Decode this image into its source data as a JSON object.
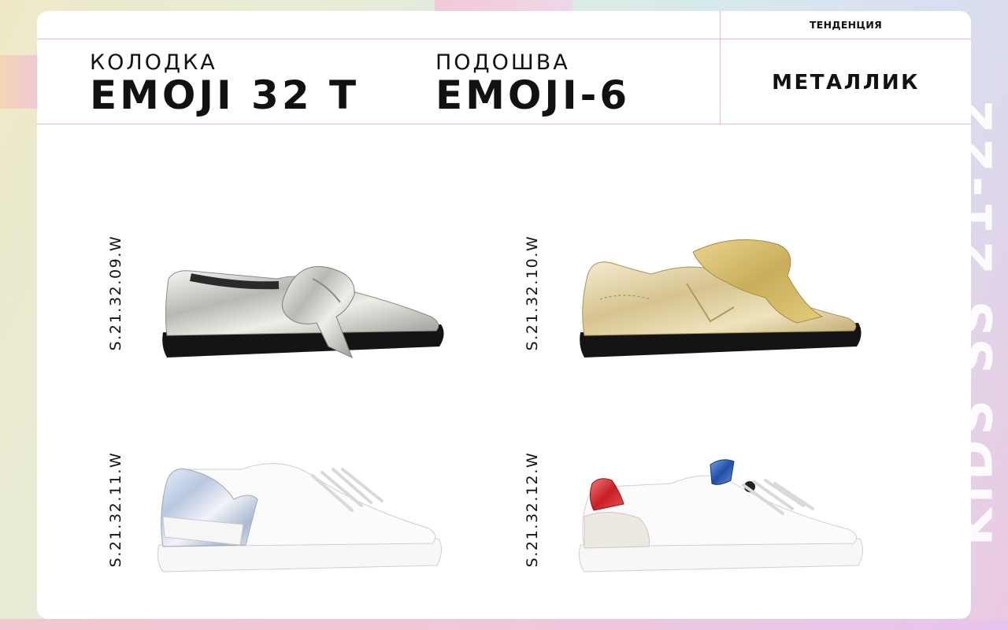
{
  "header": {
    "last_label": "КОЛОДКА",
    "last_value": "EMOJI 32 T",
    "sole_label": "ПОДОШВА",
    "sole_value": "EMOJI-6",
    "trend_label": "ТЕНДЕНЦИЯ",
    "trend_value": "МЕТАЛЛИК"
  },
  "side_title": "KIDS SS 21-22",
  "products": [
    {
      "sku": "S.21.32.09.W",
      "style": "silver metallic slip-on with bow"
    },
    {
      "sku": "S.21.32.10.W",
      "style": "gold metallic sneaker with glitter bow"
    },
    {
      "sku": "S.21.32.11.W",
      "style": "white sneaker with holographic heel"
    },
    {
      "sku": "S.21.32.12.W",
      "style": "white sneaker with red and blue metallic accents"
    }
  ],
  "colors": {
    "accent_line": "#f0b5cd",
    "text": "#111111",
    "sole_black": "#141414"
  }
}
